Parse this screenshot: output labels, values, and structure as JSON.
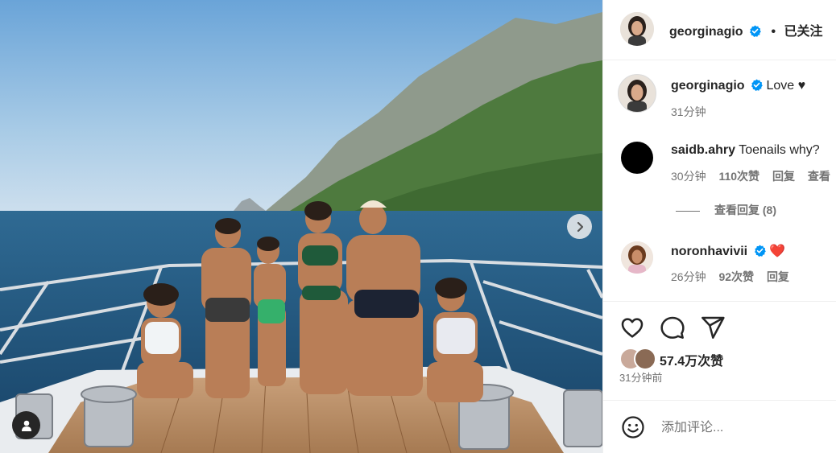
{
  "post": {
    "author": "georginagio",
    "follow_state": "已关注",
    "follow_separator": "•",
    "carousel_next_icon": "chevron-right-icon",
    "tagged_user_icon": "person-icon"
  },
  "comments": [
    {
      "username": "georginagio",
      "text": "Love",
      "emoji": "♥",
      "time": "31分钟",
      "verified": true
    },
    {
      "username": "saidb.ahry",
      "text": "Toenails why?",
      "time": "30分钟",
      "likes": "110次赞",
      "reply": "回复",
      "translate": "查看"
    },
    {
      "username": "noronhavivii",
      "text": "",
      "emoji": "❤️",
      "time": "26分钟",
      "likes": "92次赞",
      "reply": "回复",
      "verified": true
    }
  ],
  "view_replies": "查看回复 (8)",
  "actions": {
    "like_icon": "heart-icon",
    "comment_icon": "comment-icon",
    "share_icon": "send-icon"
  },
  "likes": {
    "count_text": "57.4万次赞"
  },
  "posted_time": "31分钟前",
  "add_comment": {
    "placeholder": "添加评论...",
    "emoji_icon": "smiley-icon"
  },
  "colors": {
    "verified_blue": "#0095f6",
    "heart_red": "#ed4956",
    "muted_text": "#737373",
    "text": "#262626"
  }
}
